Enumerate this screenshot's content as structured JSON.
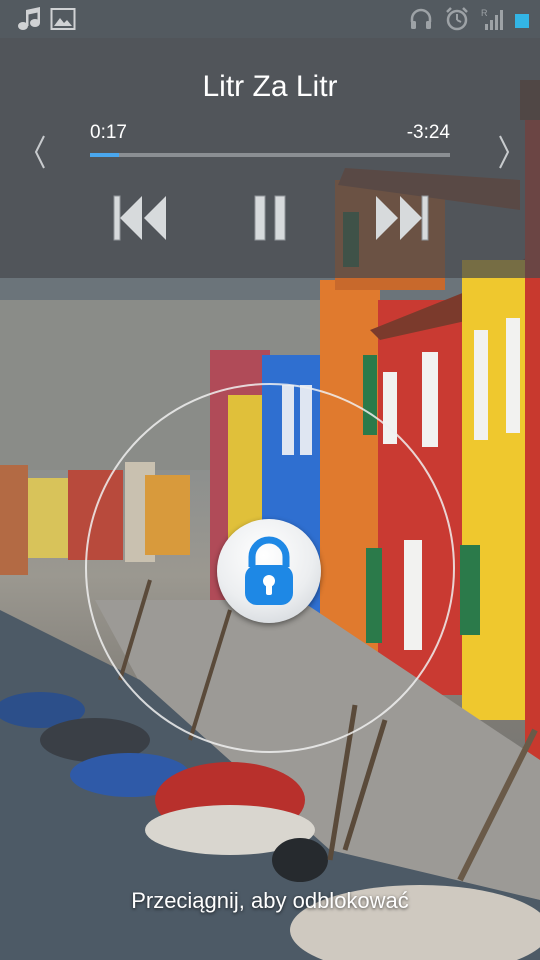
{
  "status_bar": {
    "left_icons": [
      "music-note-icon",
      "image-icon"
    ],
    "right_icons": [
      "headphones-icon",
      "alarm-clock-icon",
      "signal-icon",
      "battery-icon"
    ],
    "signal_label": "R",
    "battery_color": "#33b5e5"
  },
  "media": {
    "title": "Litr Za Litr",
    "elapsed": "0:17",
    "remaining": "-3:24",
    "progress_fraction": 0.08,
    "accent_color": "#4aa7ee",
    "controls": [
      "previous-icon",
      "pause-icon",
      "next-icon"
    ]
  },
  "lockscreen": {
    "lock_icon": "padlock-icon",
    "lock_color": "#1e88e5",
    "hint": "Przeciągnij, aby odblokować"
  }
}
